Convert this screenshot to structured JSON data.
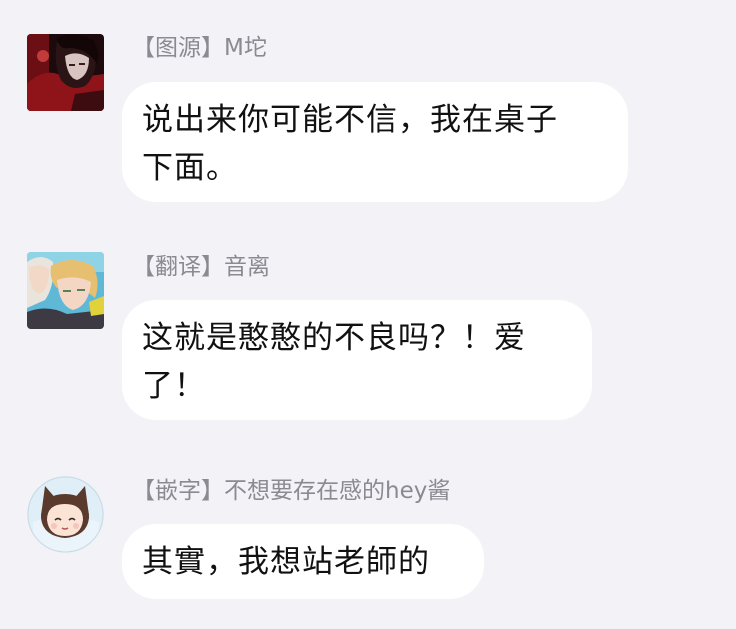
{
  "messages": [
    {
      "sender": "【图源】M坨",
      "avatar_icon": "dark-anime-avatar-icon",
      "lines": [
        "说出来你可能不信，我在桌子",
        "下面。"
      ]
    },
    {
      "sender": "【翻译】音离",
      "avatar_icon": "blonde-anime-avatar-icon",
      "lines": [
        "这就是憨憨的不良吗？！爱",
        "了！"
      ]
    },
    {
      "sender": "【嵌字】不想要存在感的hey酱",
      "avatar_icon": "cat-ear-chibi-avatar-icon",
      "lines": [
        "其實，我想站老師的"
      ]
    }
  ],
  "colors": {
    "background": "#f2f2f7",
    "bubble": "#ffffff",
    "sender_text": "#8a8a90",
    "message_text": "#111111"
  }
}
